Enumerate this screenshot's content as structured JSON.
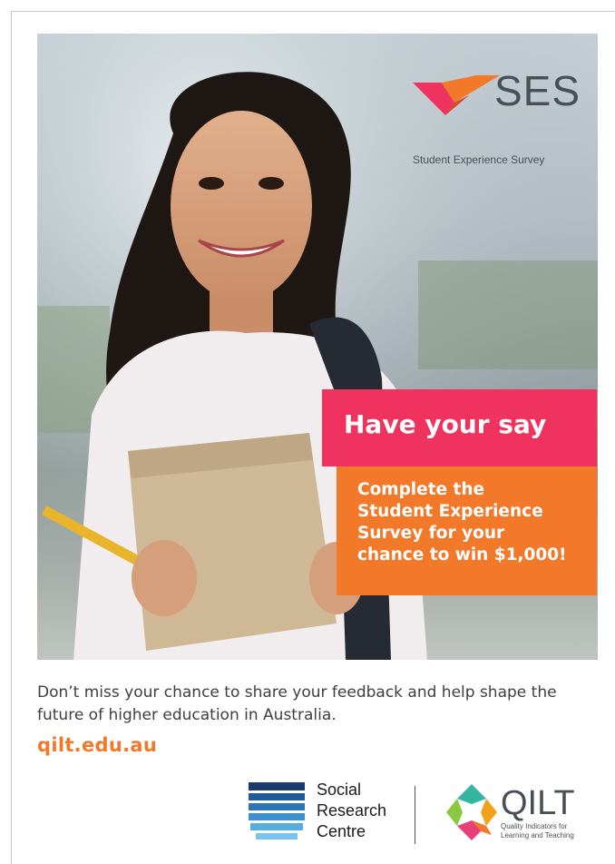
{
  "brand": {
    "logo_text": "SES",
    "logo_subtitle": "Student Experience Survey",
    "accent_pink": "#f0325e",
    "accent_orange": "#f2792a"
  },
  "banner": {
    "headline": "Have your say",
    "body_lines": [
      "Complete the",
      "Student Experience",
      "Survey for your",
      "chance to win $1,000!"
    ]
  },
  "footer": {
    "tagline": "Don’t miss your chance to share your feedback and help shape the future of higher education in Australia.",
    "url": "qilt.edu.au",
    "partner_src_lines": [
      "Social",
      "Research",
      "Centre"
    ],
    "partner_qilt_name": "QILT",
    "partner_qilt_sub_lines": [
      "Quality Indicators for",
      "Learning and Teaching"
    ]
  },
  "hero_image": {
    "icon": "student-photo"
  }
}
